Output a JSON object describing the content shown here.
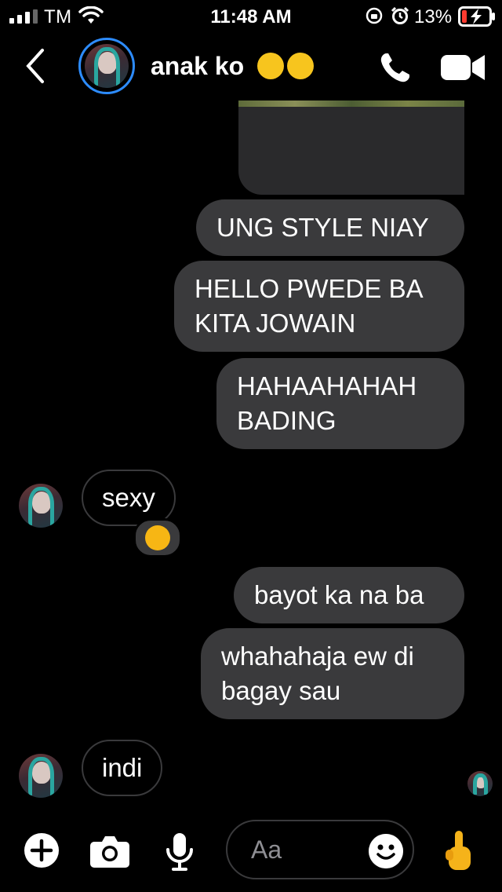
{
  "status_bar": {
    "carrier": "TM",
    "time": "11:48 AM",
    "battery": "13%"
  },
  "header": {
    "contact_name": "anak ko",
    "title_emojis": [
      "rofl-emoji",
      "rofl-emoji"
    ]
  },
  "messages": [
    {
      "from": "me",
      "type": "image"
    },
    {
      "from": "me",
      "text": "UNG STYLE NIAY"
    },
    {
      "from": "me",
      "text": "HELLO PWEDE BA KITA JOWAIN"
    },
    {
      "from": "me",
      "text": "HAHAAHAHAH BADING"
    },
    {
      "from": "them",
      "text": "sexy",
      "reaction": "angry-face-emoji"
    },
    {
      "from": "me",
      "text": "bayot ka na ba"
    },
    {
      "from": "me",
      "text": "whahahaja ew di bagay sau"
    },
    {
      "from": "them",
      "text": "indi"
    }
  ],
  "composer": {
    "placeholder": "Aa"
  },
  "colors": {
    "accent": "#2d8cff",
    "bubble": "#3a3a3c",
    "background": "#000000"
  }
}
